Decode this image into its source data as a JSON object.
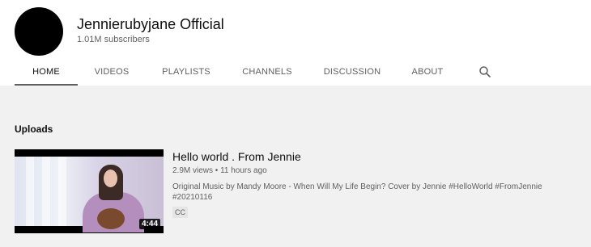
{
  "channel": {
    "name": "Jennierubyjane Official",
    "subscribers": "1.01M subscribers"
  },
  "tabs": [
    {
      "label": "HOME",
      "active": true
    },
    {
      "label": "VIDEOS"
    },
    {
      "label": "PLAYLISTS"
    },
    {
      "label": "CHANNELS"
    },
    {
      "label": "DISCUSSION"
    },
    {
      "label": "ABOUT"
    }
  ],
  "search_icon": "search-icon",
  "uploads": {
    "title": "Uploads",
    "videos": [
      {
        "title": "Hello world . From Jennie",
        "meta": "2.9M views • 11 hours ago",
        "description": "Original Music by Mandy Moore - When Will My Life Begin? Cover by Jennie #HelloWorld #FromJennie #20210116",
        "duration": "4:44",
        "badge": "CC"
      }
    ]
  },
  "colors": {
    "header_bg": "#ffffff",
    "page_bg": "#f1f1f1",
    "text_primary": "#0f0f0f",
    "text_secondary": "#606060"
  }
}
